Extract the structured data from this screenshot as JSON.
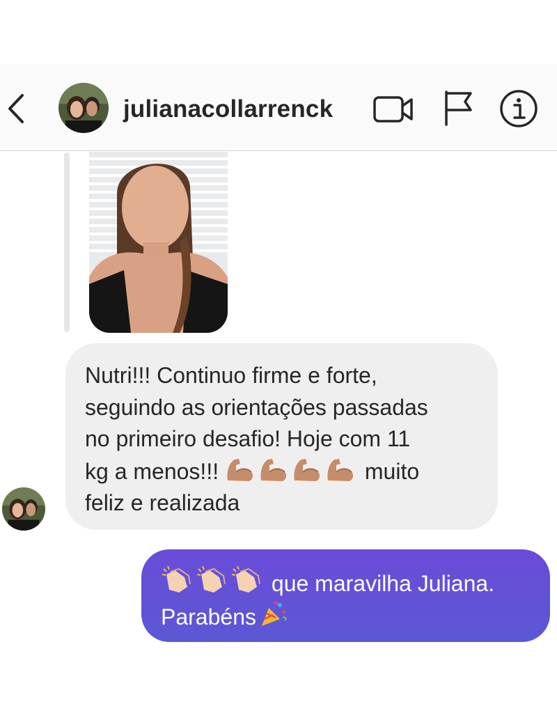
{
  "header": {
    "username": "julianacollarrenck",
    "icons": [
      "back-chevron-icon",
      "video-call-icon",
      "flag-icon",
      "info-icon"
    ]
  },
  "messages": [
    {
      "type": "video-thumbnail",
      "from": "other"
    },
    {
      "type": "text",
      "from": "other",
      "lines": [
        "Nutri!!! Continuo firme e forte,",
        "seguindo as orientações passadas",
        "no primeiro desafio!  Hoje com 11",
        "kg a menos!!!",
        "muito",
        "feliz e realizada"
      ],
      "emoji": [
        "muscle-emoji",
        "muscle-emoji",
        "muscle-emoji",
        "muscle-emoji"
      ]
    },
    {
      "type": "text",
      "from": "me",
      "lines": [
        "que maravilha Juliana.",
        "Parabéns"
      ],
      "emoji": [
        "clap-emoji",
        "clap-emoji",
        "clap-emoji",
        "party-popper-emoji"
      ]
    }
  ],
  "colors": {
    "header_bg": "#fafafa",
    "incoming_bubble": "#efefef",
    "outgoing_bubble_top": "#6a4cd8",
    "outgoing_bubble_bottom": "#5b58d5",
    "text_dark": "#262626"
  }
}
